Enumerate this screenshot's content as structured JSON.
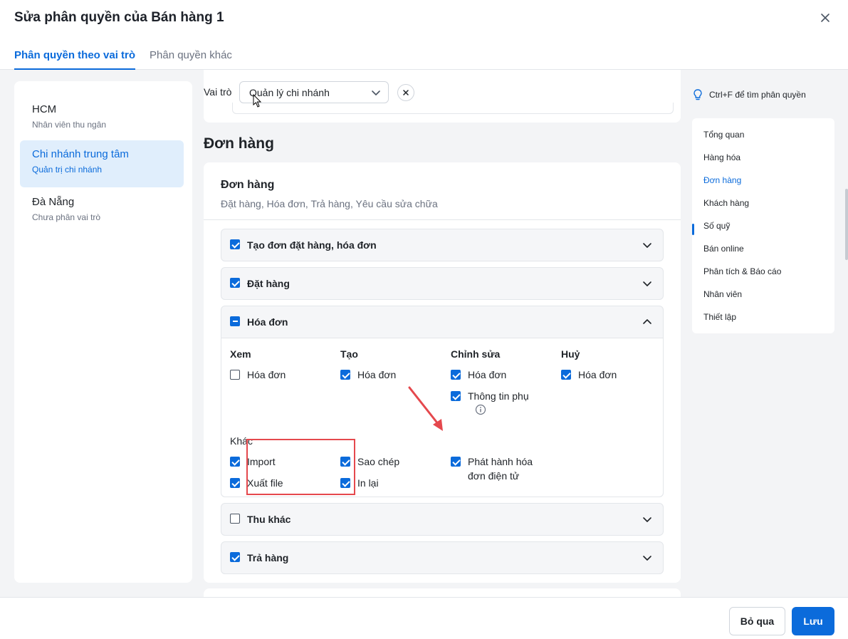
{
  "dialog": {
    "title": "Sửa phân quyền của Bán hàng 1"
  },
  "tabs": [
    {
      "label": "Phân quyền theo vai trò",
      "active": true
    },
    {
      "label": "Phân quyền khác",
      "active": false
    }
  ],
  "branches": [
    {
      "name": "HCM",
      "role": "Nhân viên thu ngân",
      "active": false
    },
    {
      "name": "Chi nhánh trung tâm",
      "role": "Quản trị chi nhánh",
      "active": true
    },
    {
      "name": "Đà Nẵng",
      "role": "Chưa phân vai trò",
      "active": false
    }
  ],
  "role": {
    "label": "Vai trò",
    "value": "Quản lý chi nhánh"
  },
  "section": {
    "title": "Đơn hàng"
  },
  "card": {
    "title": "Đơn hàng",
    "subtitle": "Đặt hàng, Hóa đơn, Trả hàng, Yêu cầu sửa chữa"
  },
  "groups": [
    {
      "label": "Tạo đơn đặt hàng, hóa đơn",
      "state": "checked",
      "expanded": false
    },
    {
      "label": "Đặt hàng",
      "state": "checked",
      "expanded": false
    },
    {
      "label": "Hóa đơn",
      "state": "partial",
      "expanded": true
    },
    {
      "label": "Thu khác",
      "state": "unchecked",
      "expanded": false
    },
    {
      "label": "Trả hàng",
      "state": "checked",
      "expanded": false
    }
  ],
  "invoice": {
    "columns": [
      {
        "title": "Xem",
        "items": [
          {
            "label": "Hóa đơn",
            "checked": false
          }
        ]
      },
      {
        "title": "Tạo",
        "items": [
          {
            "label": "Hóa đơn",
            "checked": true
          }
        ]
      },
      {
        "title": "Chỉnh sửa",
        "items": [
          {
            "label": "Hóa đơn",
            "checked": true
          },
          {
            "label": "Thông tin phụ",
            "checked": true
          }
        ]
      },
      {
        "title": "Huỷ",
        "items": [
          {
            "label": "Hóa đơn",
            "checked": true
          }
        ]
      }
    ],
    "other": {
      "title": "Khác",
      "items": [
        {
          "label": "Import",
          "checked": true
        },
        {
          "label": "Xuất file",
          "checked": true
        },
        {
          "label": "Sao chép",
          "checked": true
        },
        {
          "label": "In lại",
          "checked": true
        },
        {
          "label_line1": "Phát hành hóa",
          "label_line2": "đơn điện tử",
          "checked": true
        }
      ]
    }
  },
  "hint": {
    "text": "Ctrl+F để tìm phân quyền"
  },
  "toc": [
    {
      "label": "Tổng quan",
      "active": false
    },
    {
      "label": "Hàng hóa",
      "active": false
    },
    {
      "label": "Đơn hàng",
      "active": true
    },
    {
      "label": "Khách hàng",
      "active": false
    },
    {
      "label": "Số quỹ",
      "active": false
    },
    {
      "label": "Bán online",
      "active": false
    },
    {
      "label": "Phân tích & Báo cáo",
      "active": false
    },
    {
      "label": "Nhân viên",
      "active": false
    },
    {
      "label": "Thiết lập",
      "active": false
    }
  ],
  "footer": {
    "skip_label": "Bỏ qua",
    "save_label": "Lưu"
  },
  "colors": {
    "accent": "#0b6bdb",
    "highlight": "#e5484d",
    "active_bg": "#e0eefc"
  }
}
